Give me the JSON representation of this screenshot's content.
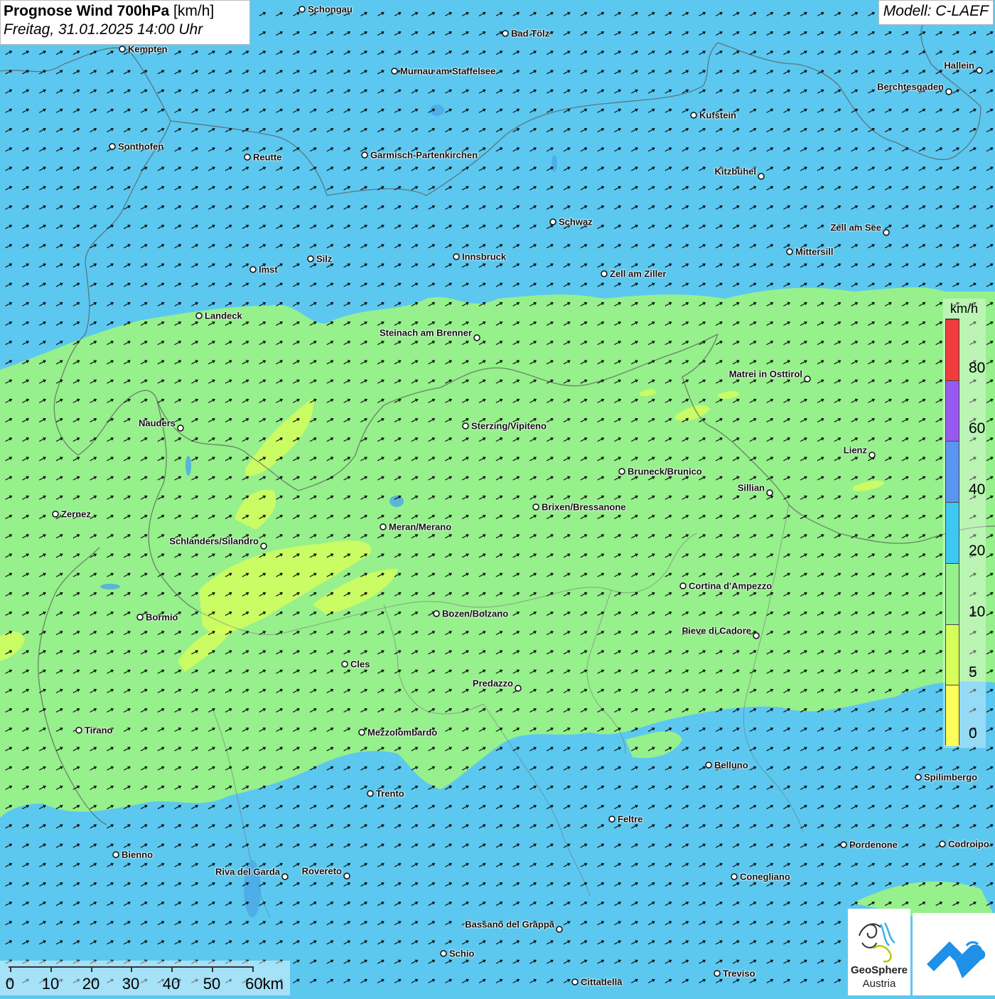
{
  "header": {
    "title_bold": "Prognose Wind 700hPa",
    "title_unit": "[km/h]",
    "datetime": "Freitag, 31.01.2025 14:00 Uhr",
    "model": "Modell: C-LAEF"
  },
  "legend": {
    "unit": "km/h",
    "classes": [
      {
        "label": "0",
        "color": "#ffff5a"
      },
      {
        "label": "5",
        "color": "#d7ff5a"
      },
      {
        "label": "10",
        "color": "#96f08c"
      },
      {
        "label": "20",
        "color": "#3cc8f0"
      },
      {
        "label": "40",
        "color": "#5a96f0"
      },
      {
        "label": "60",
        "color": "#965af0"
      },
      {
        "label": "80",
        "color": "#f03c3c"
      }
    ]
  },
  "scale_bar": {
    "labels": [
      "0",
      "10",
      "20",
      "30",
      "40",
      "50",
      "60km"
    ]
  },
  "logos": {
    "geosphere_line1": "GeoSphere",
    "geosphere_line2": "Austria"
  },
  "cities": [
    {
      "name": "Schongau",
      "side": "right"
    },
    {
      "name": "Bad Tölz",
      "side": "right"
    },
    {
      "name": "Kempten",
      "side": "right"
    },
    {
      "name": "Murnau am Staffelsee",
      "side": "right"
    },
    {
      "name": "Hallein",
      "side": "left"
    },
    {
      "name": "Berchtesgaden",
      "side": "left"
    },
    {
      "name": "Kufstein",
      "side": "right"
    },
    {
      "name": "Sonthofen",
      "side": "right"
    },
    {
      "name": "Reutte",
      "side": "right"
    },
    {
      "name": "Garmisch-Partenkirchen",
      "side": "right"
    },
    {
      "name": "Kitzbühel",
      "side": "left"
    },
    {
      "name": "Schwaz",
      "side": "right"
    },
    {
      "name": "Zell am See",
      "side": "left"
    },
    {
      "name": "Mittersill",
      "side": "right"
    },
    {
      "name": "Innsbruck",
      "side": "right"
    },
    {
      "name": "Imst",
      "side": "right"
    },
    {
      "name": "Silz",
      "side": "right"
    },
    {
      "name": "Zell am Ziller",
      "side": "right"
    },
    {
      "name": "Landeck",
      "side": "right"
    },
    {
      "name": "Steinach am Brenner",
      "side": "left"
    },
    {
      "name": "Matrei in Osttirol",
      "side": "left"
    },
    {
      "name": "Nauders",
      "side": "left"
    },
    {
      "name": "Sterzing/Vipiteno",
      "side": "right"
    },
    {
      "name": "Lienz",
      "side": "left"
    },
    {
      "name": "Bruneck/Brunico",
      "side": "right"
    },
    {
      "name": "Sillian",
      "side": "left"
    },
    {
      "name": "Zernez",
      "side": "right"
    },
    {
      "name": "Brixen/Bressanone",
      "side": "right"
    },
    {
      "name": "Meran/Merano",
      "side": "right"
    },
    {
      "name": "Schlanders/Silandro",
      "side": "left"
    },
    {
      "name": "Cortina d'Ampezzo",
      "side": "right"
    },
    {
      "name": "Bozen/Bolzano",
      "side": "right"
    },
    {
      "name": "Bormio",
      "side": "right"
    },
    {
      "name": "Pieve di Cadore",
      "side": "left"
    },
    {
      "name": "Cles",
      "side": "right"
    },
    {
      "name": "Predazzo",
      "side": "left"
    },
    {
      "name": "Tirano",
      "side": "right"
    },
    {
      "name": "Mezzolombardo",
      "side": "right"
    },
    {
      "name": "Belluno",
      "side": "right"
    },
    {
      "name": "Spilimbergo",
      "side": "right"
    },
    {
      "name": "Trento",
      "side": "right"
    },
    {
      "name": "Feltre",
      "side": "right"
    },
    {
      "name": "Pordenone",
      "side": "right"
    },
    {
      "name": "Codroipo",
      "side": "right"
    },
    {
      "name": "Bienno",
      "side": "right"
    },
    {
      "name": "Riva del Garda",
      "side": "left"
    },
    {
      "name": "Rovereto",
      "side": "left"
    },
    {
      "name": "Conegliano",
      "side": "right"
    },
    {
      "name": "Bassano del Grappa",
      "side": "left"
    },
    {
      "name": "Schio",
      "side": "right"
    },
    {
      "name": "Treviso",
      "side": "right"
    },
    {
      "name": "Cittadella",
      "side": "right"
    }
  ]
}
